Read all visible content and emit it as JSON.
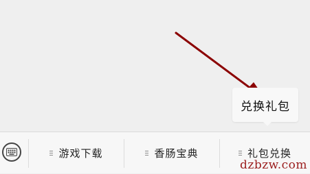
{
  "popup": {
    "label": "兑换礼包"
  },
  "menubar": {
    "keyboard_icon": "keyboard-icon",
    "items": [
      {
        "label": "游戏下载",
        "icon": "menu-list-icon"
      },
      {
        "label": "香肠宝典",
        "icon": "menu-list-icon"
      },
      {
        "label": "礼包兑换",
        "icon": "menu-list-icon"
      }
    ]
  },
  "annotation": {
    "arrow_color": "#8b0000"
  },
  "watermark": "dzbzw.com"
}
